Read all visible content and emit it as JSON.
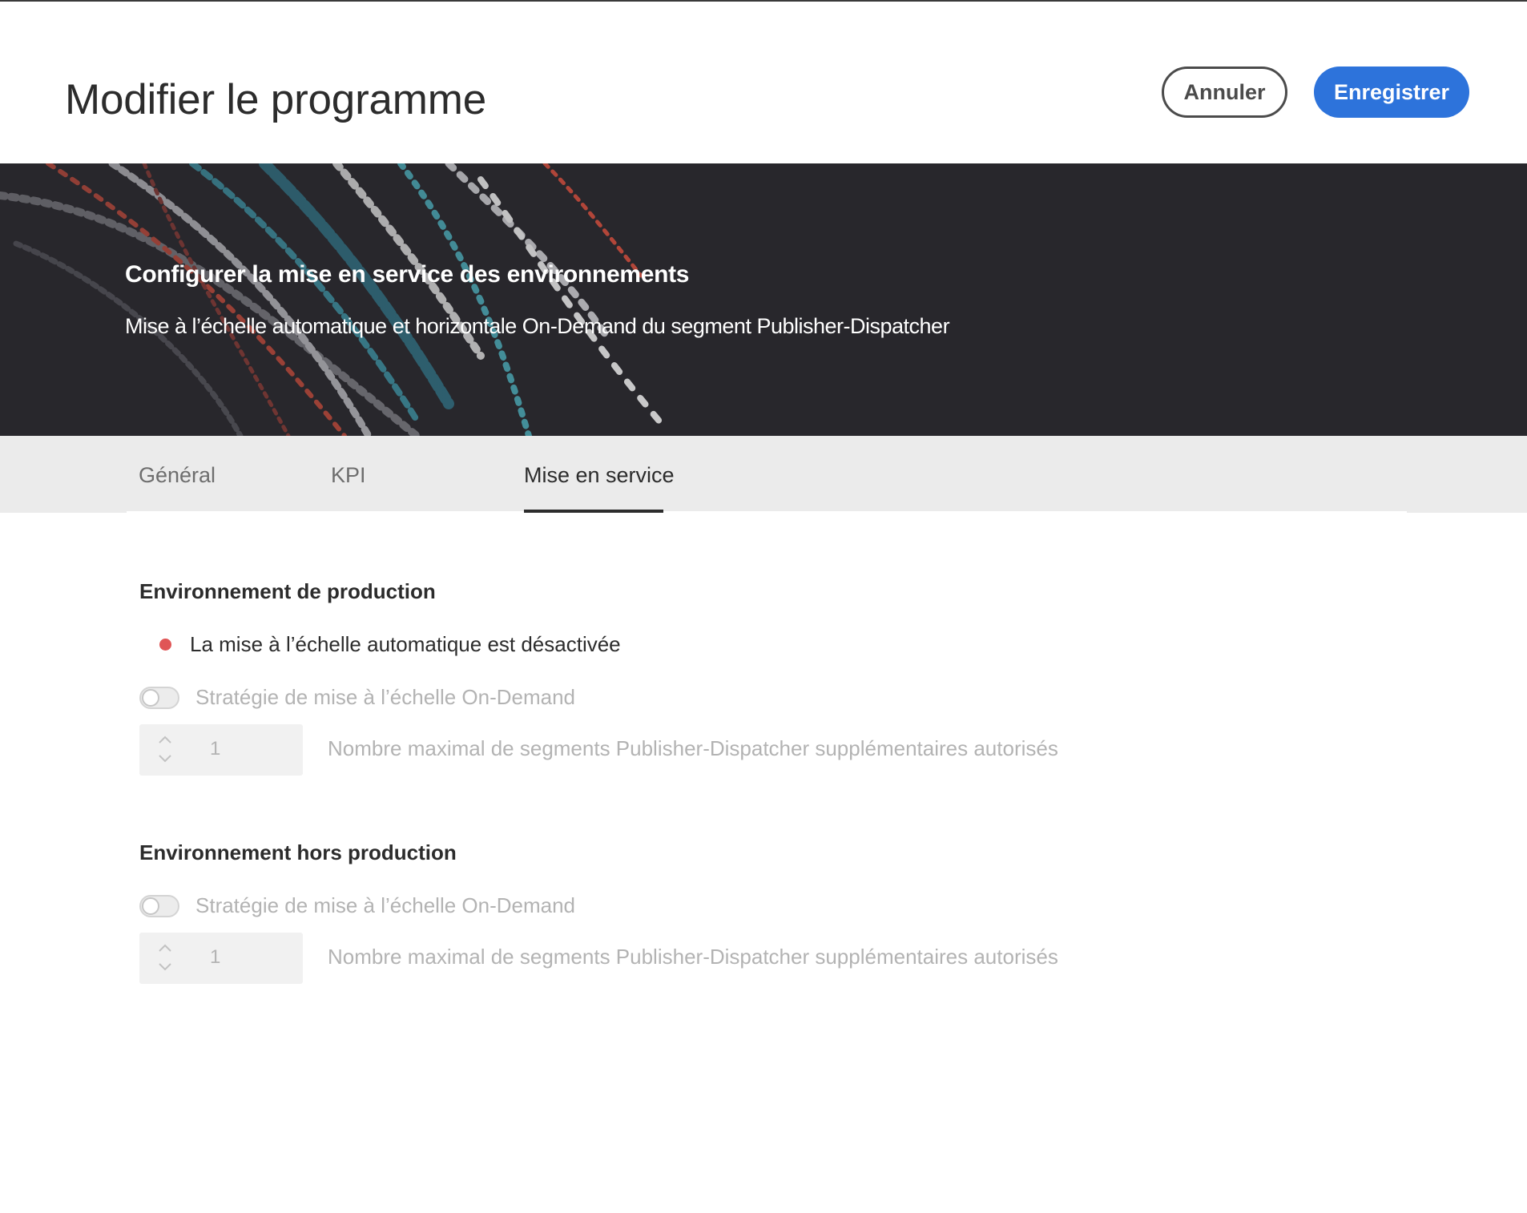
{
  "header": {
    "title": "Modifier le programme",
    "cancel_label": "Annuler",
    "save_label": "Enregistrer",
    "save_color": "#2d73db"
  },
  "banner": {
    "title": "Configurer la mise en service des environnements",
    "subtitle": "Mise à l’échelle automatique et horizontale On-Demand du segment Publisher-Dispatcher"
  },
  "tabs": [
    {
      "label": "Général",
      "active": false
    },
    {
      "label": "KPI",
      "active": false
    },
    {
      "label": "Mise en service",
      "active": true
    }
  ],
  "production": {
    "title": "Environnement de production",
    "status_text": "La mise à l’échelle automatique est désactivée",
    "status_color": "#e05556",
    "toggle_label": "Stratégie de mise à l’échelle On-Demand",
    "toggle_on": false,
    "stepper_value": "1",
    "stepper_label": "Nombre maximal de segments Publisher-Dispatcher supplémentaires autorisés"
  },
  "non_production": {
    "title": "Environnement hors production",
    "toggle_label": "Stratégie de mise à l’échelle On-Demand",
    "toggle_on": false,
    "stepper_value": "1",
    "stepper_label": "Nombre maximal de segments Publisher-Dispatcher supplémentaires autorisés"
  },
  "icons": [
    "chevron-up-icon",
    "chevron-down-icon",
    "status-dot-icon"
  ]
}
